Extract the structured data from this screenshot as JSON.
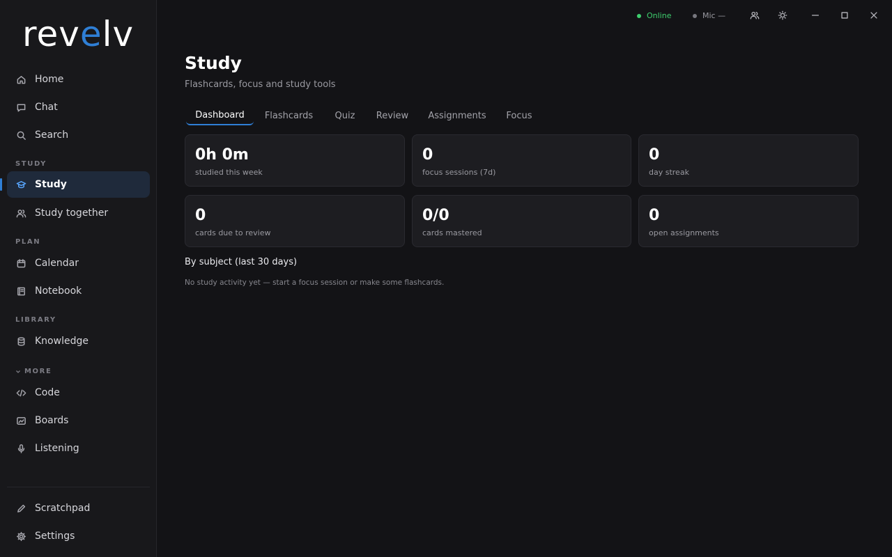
{
  "app": {
    "logo_pre": "rev",
    "logo_accent": "e",
    "logo_post": "lv"
  },
  "sidebar": {
    "items_top": [
      {
        "label": "Home",
        "icon": "home-icon"
      },
      {
        "label": "Chat",
        "icon": "chat-icon"
      },
      {
        "label": "Search",
        "icon": "search-icon"
      }
    ],
    "sections": {
      "study": "STUDY",
      "plan": "PLAN",
      "library": "LIBRARY",
      "more": "MORE"
    },
    "study_items": [
      {
        "label": "Study",
        "icon": "graduation-cap-icon",
        "active": true
      },
      {
        "label": "Study together",
        "icon": "users-icon"
      }
    ],
    "plan_items": [
      {
        "label": "Calendar",
        "icon": "calendar-icon"
      },
      {
        "label": "Notebook",
        "icon": "notebook-icon"
      }
    ],
    "library_items": [
      {
        "label": "Knowledge",
        "icon": "database-icon"
      }
    ],
    "more_items": [
      {
        "label": "Code",
        "icon": "code-icon"
      },
      {
        "label": "Boards",
        "icon": "board-icon"
      },
      {
        "label": "Listening",
        "icon": "microphone-icon"
      }
    ],
    "bottom_items": [
      {
        "label": "Scratchpad",
        "icon": "pencil-icon"
      },
      {
        "label": "Settings",
        "icon": "gear-icon"
      }
    ]
  },
  "topbar": {
    "online_label": "Online",
    "online_color": "#3ecf6e",
    "mic_label": "Mic —",
    "mic_color": "#77777e"
  },
  "page": {
    "title": "Study",
    "subtitle": "Flashcards, focus and study tools"
  },
  "tabs": [
    "Dashboard",
    "Flashcards",
    "Quiz",
    "Review",
    "Assignments",
    "Focus"
  ],
  "active_tab": "Dashboard",
  "stats": [
    {
      "value": "0h 0m",
      "caption": "studied this week"
    },
    {
      "value": "0",
      "caption": "focus sessions (7d)"
    },
    {
      "value": "0",
      "caption": "day streak"
    },
    {
      "value": "0",
      "caption": "cards due to review"
    },
    {
      "value": "0/0",
      "caption": "cards mastered"
    },
    {
      "value": "0",
      "caption": "open assignments"
    }
  ],
  "by_subject": {
    "title": "By subject (last 30 days)",
    "empty_text": "No study activity yet — start a focus session or make some flashcards."
  },
  "colors": {
    "accent": "#2f7fd6",
    "background": "#131316",
    "sidebar": "#18181b"
  }
}
